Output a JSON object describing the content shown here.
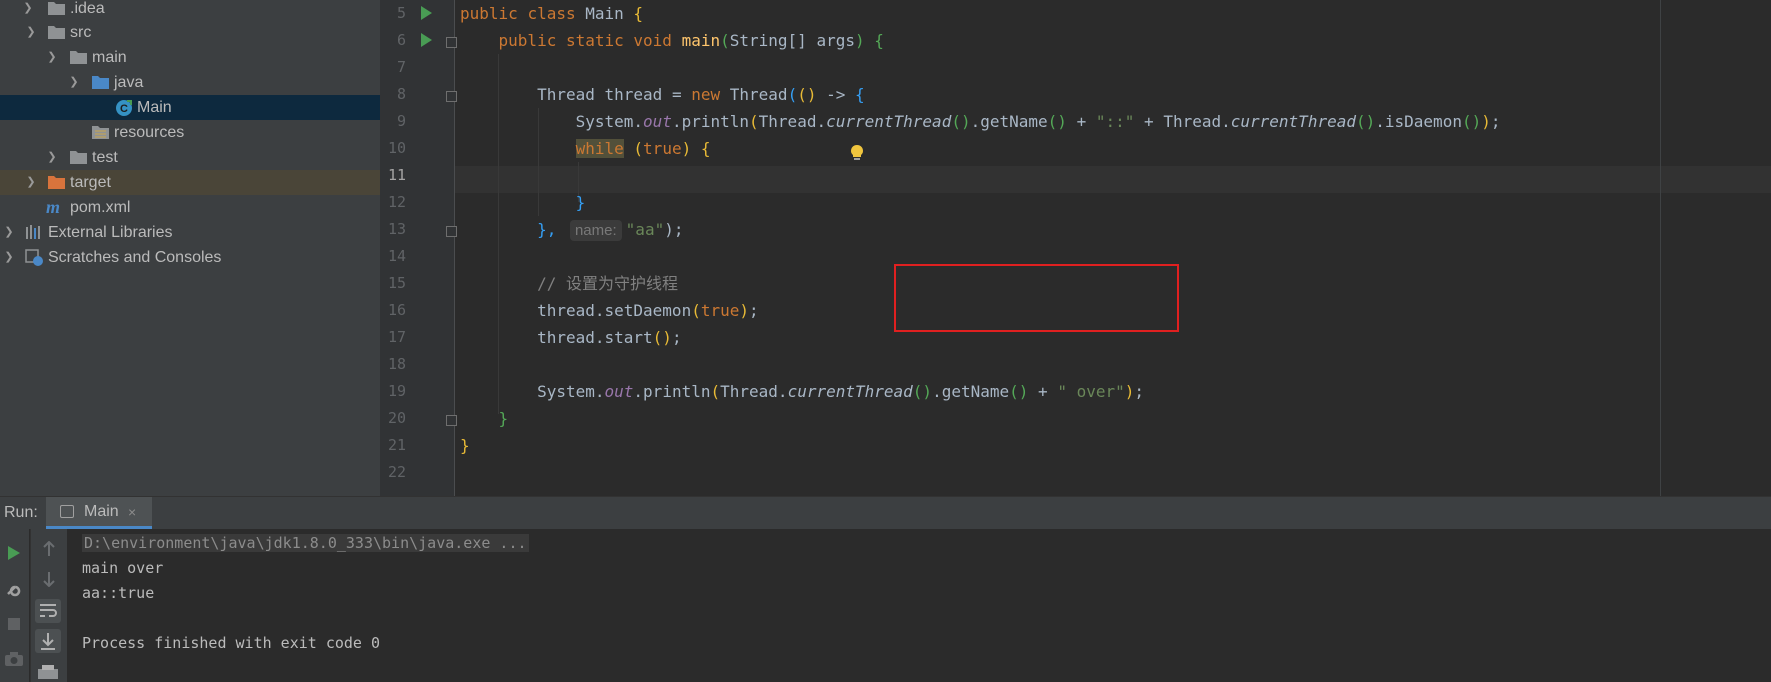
{
  "project_tree": {
    "items": [
      {
        "label": ".idea"
      },
      {
        "label": "src"
      },
      {
        "label": "main"
      },
      {
        "label": "java"
      },
      {
        "label": "Main"
      },
      {
        "label": "resources"
      },
      {
        "label": "test"
      },
      {
        "label": "target"
      },
      {
        "label": "pom.xml"
      },
      {
        "label": "External Libraries"
      },
      {
        "label": "Scratches and Consoles"
      }
    ]
  },
  "editor": {
    "line_numbers": [
      "5",
      "6",
      "7",
      "8",
      "9",
      "10",
      "11",
      "12",
      "13",
      "14",
      "15",
      "16",
      "17",
      "18",
      "19",
      "20",
      "21",
      "22"
    ],
    "current_line": "11",
    "inlay_hint": "name:",
    "code": {
      "l5": {
        "kw1": "public",
        "kw2": "class",
        "name": "Main",
        "brace": "{"
      },
      "l6": {
        "kw1": "public",
        "kw2": "static",
        "kw3": "void",
        "name": "main",
        "params": "String[] args",
        "brace": "{"
      },
      "l8": {
        "type": "Thread",
        "var": "thread",
        "eq": "=",
        "kw": "new",
        "ctor": "Thread",
        "lambda": "->",
        "brace": "{"
      },
      "l9": {
        "cls": "System",
        "field": "out",
        "call": "println",
        "cls2": "Thread",
        "m1": "currentThread",
        "getname": "getName",
        "plus": "+",
        "str": "\"::\"",
        "m2": "currentThread",
        "isdaemon": "isDaemon",
        "end": ");"
      },
      "l10": {
        "kw": "while",
        "kw2": "true",
        "brace": "{"
      },
      "l12": {
        "brace": "}"
      },
      "l13": {
        "close": "},",
        "str": "\"aa\"",
        "end": ");"
      },
      "l15": {
        "comment": "// 设置为守护线程"
      },
      "l16": {
        "obj": "thread",
        "method": "setDaemon",
        "kw": "true",
        "end": ");"
      },
      "l17": {
        "obj": "thread",
        "method": "start",
        "end": ";"
      },
      "l19": {
        "cls": "System",
        "field": "out",
        "call": "println",
        "cls2": "Thread",
        "m1": "currentThread",
        "getname": "getName",
        "plus": "+",
        "str": "\" over\"",
        "end": ");"
      },
      "l20": {
        "brace": "}"
      },
      "l21": {
        "brace": "}"
      }
    }
  },
  "run_panel": {
    "label": "Run:",
    "tab_label": "Main",
    "tab_close": "×",
    "console_lines": [
      "D:\\environment\\java\\jdk1.8.0_333\\bin\\java.exe ...",
      "main over",
      "aa::true",
      "",
      "Process finished with exit code 0"
    ]
  },
  "colors": {
    "keyword": "#cc7832",
    "method": "#ffc66d",
    "string": "#6a8759",
    "static_field": "#9876aa",
    "comment": "#808080",
    "highlight_box": "#e02020",
    "selection": "#0d293e"
  }
}
